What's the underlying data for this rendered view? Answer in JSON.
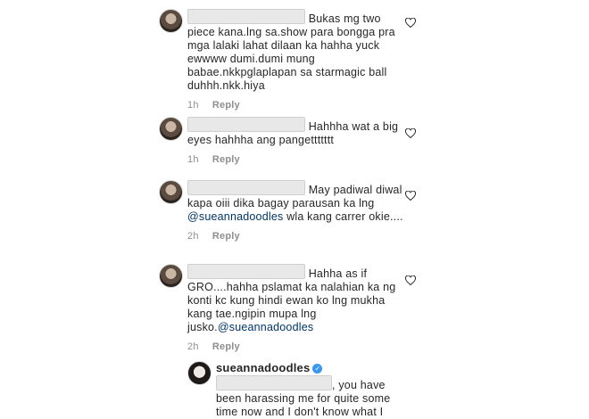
{
  "comments": [
    {
      "text_a": "Bukas mg two",
      "text_b": "piece kana.lng sa.show para bongga pra mga lalaki lahat dilaan ka hahha yuck ewwww dumi.dumi mung babae.nkkpglaplapan sa starmagic ball duhhh.nkk.hiya",
      "time": "1h",
      "reply": "Reply"
    },
    {
      "text_a": "Hahhha wat a",
      "text_b": "big eyes hahhha ang pangettttttt",
      "time": "1h",
      "reply": "Reply"
    },
    {
      "text_a": "May padiwal",
      "text_b": "diwal kapa oiii dika bagay parausan ka lng",
      "mention": "@sueannadoodles",
      "text_c": "wla kang carrer okie....",
      "time": "2h",
      "reply": "Reply"
    },
    {
      "text_a": "Hahha as if",
      "text_b": "GRO....hahha pslamat ka nalahian ka ng konti kc kung hindi ewan ko lng mukha kang tae.ngipin mupa lng jusko.",
      "mention": "@sueannadoodles",
      "time": "2h",
      "reply": "Reply"
    }
  ],
  "reply_comment": {
    "username": "sueannadoodles",
    "verified_glyph": "✓",
    "text_a": ", you have",
    "text_b": "been harassing me for quite some time now and I don't know what I"
  },
  "colors": {
    "mention": "#003569",
    "meta": "#8e8e8e",
    "verified": "#3897f0"
  },
  "icons": [
    "heart-outline-icon",
    "verified-badge-icon"
  ]
}
